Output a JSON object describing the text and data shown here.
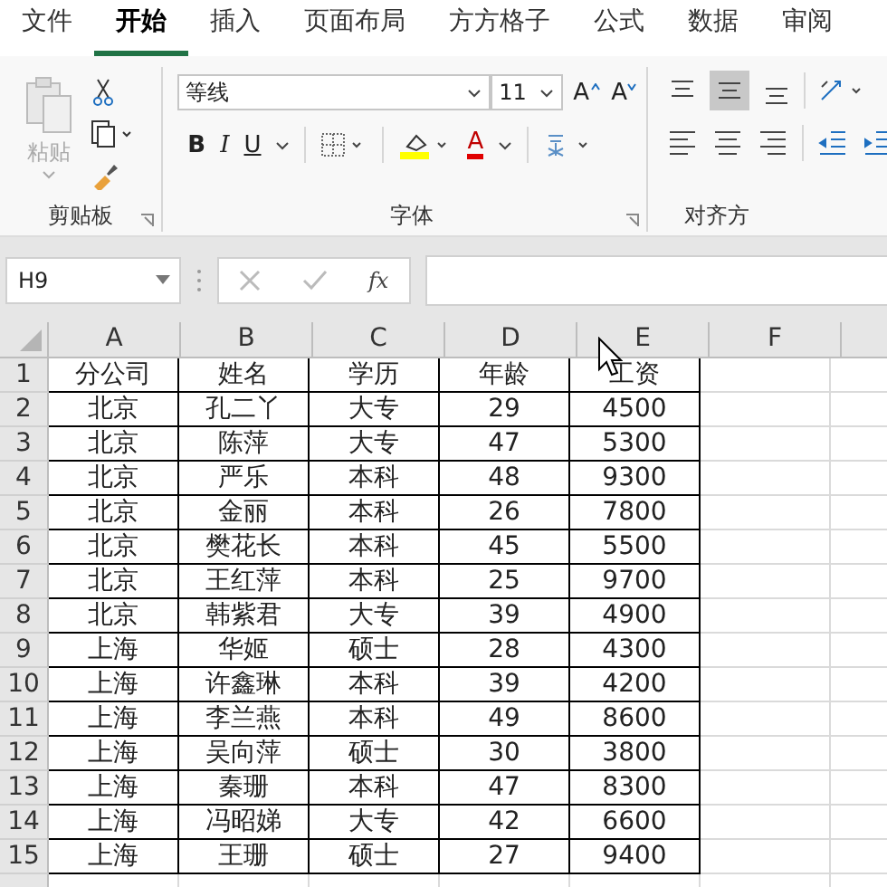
{
  "tabs": [
    {
      "label": "文件",
      "selected": false
    },
    {
      "label": "开始",
      "selected": true
    },
    {
      "label": "插入",
      "selected": false
    },
    {
      "label": "页面布局",
      "selected": false
    },
    {
      "label": "方方格子",
      "selected": false
    },
    {
      "label": "公式",
      "selected": false
    },
    {
      "label": "数据",
      "selected": false
    },
    {
      "label": "审阅",
      "selected": false
    }
  ],
  "ribbon": {
    "clipboard": {
      "paste_label": "粘贴",
      "group_label": "剪贴板"
    },
    "font": {
      "font_name": "等线",
      "font_size": "11",
      "grow_label": "A",
      "shrink_label": "A",
      "format_buttons": [
        "B",
        "I",
        "U"
      ],
      "font_color_label": "A",
      "group_label": "字体"
    },
    "alignment": {
      "group_label": "对齐方"
    }
  },
  "formula_bar": {
    "name_box": "H9",
    "fx_label": "fx"
  },
  "sheet": {
    "columns": [
      "A",
      "B",
      "C",
      "D",
      "E",
      "F"
    ],
    "rows": [
      {
        "number": "1",
        "cells": [
          "分公司",
          "姓名",
          "学历",
          "年龄",
          "工资"
        ]
      },
      {
        "number": "2",
        "cells": [
          "北京",
          "孔二丫",
          "大专",
          "29",
          "4500"
        ]
      },
      {
        "number": "3",
        "cells": [
          "北京",
          "陈萍",
          "大专",
          "47",
          "5300"
        ]
      },
      {
        "number": "4",
        "cells": [
          "北京",
          "严乐",
          "本科",
          "48",
          "9300"
        ]
      },
      {
        "number": "5",
        "cells": [
          "北京",
          "金丽",
          "本科",
          "26",
          "7800"
        ]
      },
      {
        "number": "6",
        "cells": [
          "北京",
          "樊花长",
          "本科",
          "45",
          "5500"
        ]
      },
      {
        "number": "7",
        "cells": [
          "北京",
          "王红萍",
          "本科",
          "25",
          "9700"
        ]
      },
      {
        "number": "8",
        "cells": [
          "北京",
          "韩紫君",
          "大专",
          "39",
          "4900"
        ]
      },
      {
        "number": "9",
        "cells": [
          "上海",
          "华姬",
          "硕士",
          "28",
          "4300"
        ]
      },
      {
        "number": "10",
        "cells": [
          "上海",
          "许鑫琳",
          "本科",
          "39",
          "4200"
        ]
      },
      {
        "number": "11",
        "cells": [
          "上海",
          "李兰燕",
          "本科",
          "49",
          "8600"
        ]
      },
      {
        "number": "12",
        "cells": [
          "上海",
          "吴向萍",
          "硕士",
          "30",
          "3800"
        ]
      },
      {
        "number": "13",
        "cells": [
          "上海",
          "秦珊",
          "本科",
          "47",
          "8300"
        ]
      },
      {
        "number": "14",
        "cells": [
          "上海",
          "冯昭娣",
          "大专",
          "42",
          "6600"
        ]
      },
      {
        "number": "15",
        "cells": [
          "上海",
          "王珊",
          "硕士",
          "27",
          "9400"
        ]
      }
    ]
  }
}
